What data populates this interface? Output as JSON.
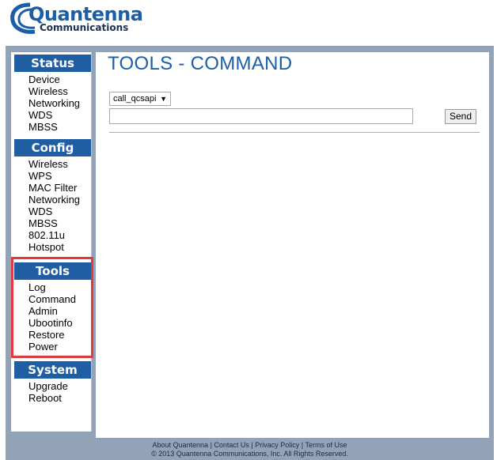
{
  "logo": {
    "brand": "Quantenna",
    "subtitle": "Communications"
  },
  "nav": {
    "status": {
      "title": "Status",
      "items": [
        "Device",
        "Wireless",
        "Networking",
        "WDS",
        "MBSS"
      ]
    },
    "config": {
      "title": "Config",
      "items": [
        "Wireless",
        "WPS",
        "MAC Filter",
        "Networking",
        "WDS",
        "MBSS",
        "802.11u",
        "Hotspot"
      ]
    },
    "tools": {
      "title": "Tools",
      "items": [
        "Log",
        "Command",
        "Admin",
        "Ubootinfo",
        "Restore",
        "Power"
      ]
    },
    "system": {
      "title": "System",
      "items": [
        "Upgrade",
        "Reboot"
      ]
    }
  },
  "main": {
    "title": "TOOLS - COMMAND",
    "select_value": "call_qcsapi",
    "command_value": "",
    "send_label": "Send"
  },
  "footer": {
    "about": "About Quantenna",
    "contact": "Contact Us",
    "privacy": "Privacy Policy",
    "terms": "Terms of Use",
    "copyright": "© 2013 Quantenna Communications, Inc. All Rights Reserved."
  },
  "colors": {
    "accent": "#1f5ea2",
    "frame": "#93a3b7",
    "highlight": "#e03a3f"
  }
}
